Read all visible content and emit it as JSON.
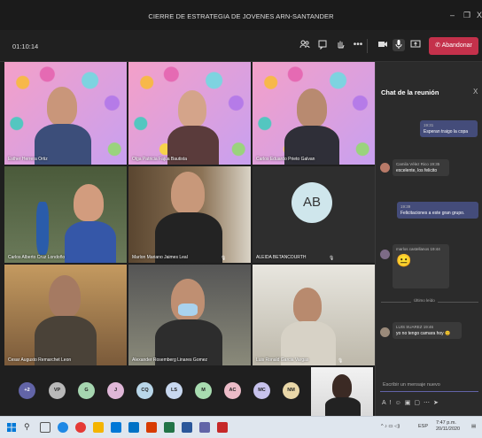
{
  "window": {
    "title": "CIERRE DE ESTRATEGIA DE JOVENES ARN-SANTANDER",
    "controls": {
      "minimize": "–",
      "restore": "❐",
      "close": "X"
    }
  },
  "toolbar": {
    "timer": "01:10:14",
    "leave_label": "Abandonar",
    "icons": [
      "participants-icon",
      "chat-icon",
      "raise-hand-icon",
      "more-icon",
      "camera-icon",
      "mic-icon",
      "share-icon"
    ]
  },
  "participants": [
    {
      "name": "Esther Herrera Ortiz"
    },
    {
      "name": "Olga Patricia Fajua Bautista"
    },
    {
      "name": "Carlos Eduardo Prieto Galvan"
    },
    {
      "name": "Carlos Alberto Cruz Londoño"
    },
    {
      "name": "Marlon Mariano Jaimes Leal"
    },
    {
      "name": "ALEIDA BETANCOURTH",
      "initials": "AB"
    },
    {
      "name": "Cesar Augusto Remarchet Leon"
    },
    {
      "name": "Alexander Rosemberg Linares Gomez"
    },
    {
      "name": "Luis Ronald Garcia Vargas"
    }
  ],
  "overflow": {
    "count": "+2",
    "avatars": [
      {
        "initials": "VP",
        "color": "#b9b9b9"
      },
      {
        "initials": "G",
        "color": "#a6d6b0"
      },
      {
        "initials": "J",
        "color": "#e0b7d8"
      },
      {
        "initials": "CQ",
        "color": "#b9d7ea"
      },
      {
        "initials": "LS",
        "color": "#c8d8f0"
      },
      {
        "initials": "M",
        "color": "#a8dcb0"
      },
      {
        "initials": "AC",
        "color": "#ecbcc8"
      },
      {
        "initials": "MC",
        "color": "#c7c2ec"
      },
      {
        "initials": "NM",
        "color": "#e9d7a8"
      }
    ]
  },
  "chat": {
    "title": "Chat de la reunión",
    "close": "X",
    "messages": [
      {
        "time": "19:31",
        "text": "Esperan traigo la copa"
      },
      {
        "author": "Camila Vélez Rico",
        "time": "19:35",
        "text": "excelente, los felicito"
      },
      {
        "time": "19:39",
        "text": "Felicitaciones a este gran grupo."
      },
      {
        "author": "marlos castellanos",
        "time": "19:44",
        "text": "😐"
      },
      {
        "author": "LUIS SUAREZ",
        "time": "19:46",
        "text": "yo no tengo camara hoy 😊"
      }
    ],
    "divider": "Último leído",
    "compose_placeholder": "Escribir un mensaje nuevo"
  },
  "taskbar": {
    "lang": "ESP",
    "clock_time": "7:47 p.m.",
    "clock_date": "20/11/2020"
  }
}
